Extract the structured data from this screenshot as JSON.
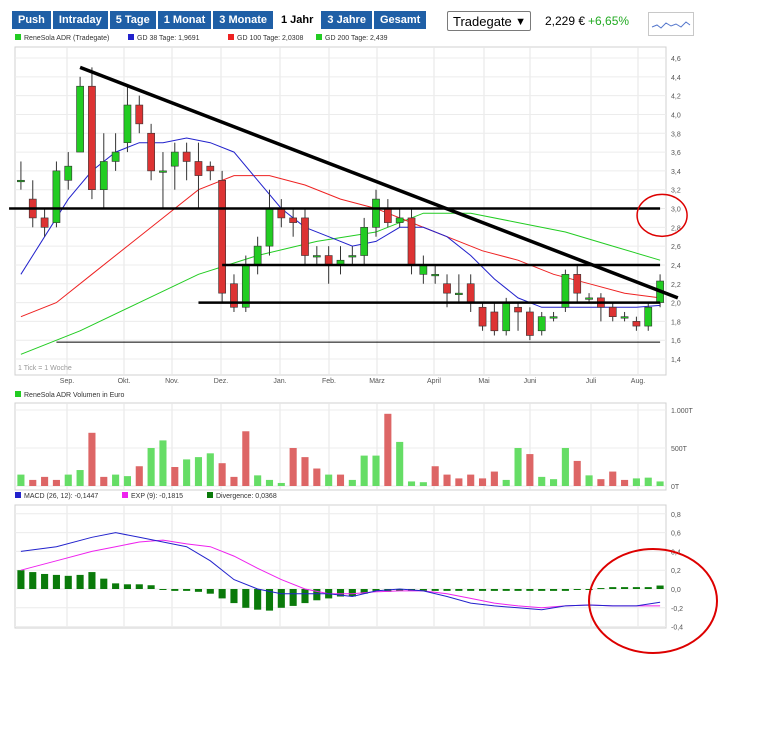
{
  "tabs": [
    {
      "label": "Push",
      "active": false
    },
    {
      "label": "Intraday",
      "active": false
    },
    {
      "label": "5 Tage",
      "active": false
    },
    {
      "label": "1 Monat",
      "active": false
    },
    {
      "label": "3 Monate",
      "active": false
    },
    {
      "label": "1 Jahr",
      "active": true
    },
    {
      "label": "3 Jahre",
      "active": false
    },
    {
      "label": "Gesamt",
      "active": false
    }
  ],
  "exchange": "Tradegate",
  "price": "2,229 €",
  "change": "+6,65%",
  "colors": {
    "up": "#22cc22",
    "down": "#dd3333",
    "gd38": "#2222cc",
    "gd100": "#ee2222",
    "gd200": "#22cc22",
    "macd": "#2222cc",
    "exp": "#ee22ee",
    "divergence": "#0a7a0a",
    "tabs": "#1f5fa6"
  },
  "main_legend": [
    "ReneSola ADR (Tradegate)",
    "GD 38 Tage: 1,9691",
    "GD 100 Tage: 2,0308",
    "GD 200 Tage: 2,439"
  ],
  "tick_note": "1 Tick = 1 Woche",
  "months": [
    "Sep.",
    "Okt.",
    "Nov.",
    "Dez.",
    "Jan.",
    "Feb.",
    "März",
    "April",
    "Mai",
    "Juni",
    "Juli",
    "Aug."
  ],
  "price_ticks": [
    "4,6",
    "4,4",
    "4,2",
    "4,0",
    "3,8",
    "3,6",
    "3,4",
    "3,2",
    "3,0",
    "2,8",
    "2,6",
    "2,4",
    "2,2",
    "2,0",
    "1,8",
    "1,6",
    "1,4"
  ],
  "volume_legend": "ReneSola ADR Volumen in Euro",
  "volume_ticks": [
    "1.000T",
    "500T",
    "0T"
  ],
  "macd_legend": [
    "MACD (26, 12): -0,1447",
    "EXP (9): -0,1815",
    "Divergence: 0,0368"
  ],
  "macd_ticks": [
    "0,8",
    "0,6",
    "0,4",
    "0,2",
    "0,0",
    "-0,2",
    "-0,4"
  ],
  "chart_data": [
    {
      "type": "candlestick",
      "title": "ReneSola ADR (Tradegate)",
      "interval": "1 Tick = 1 Woche",
      "ylim": [
        1.4,
        4.6
      ],
      "candles": [
        {
          "o": 3.3,
          "c": 3.3,
          "h": 3.5,
          "l": 3.2
        },
        {
          "o": 3.1,
          "c": 2.9,
          "h": 3.3,
          "l": 2.8
        },
        {
          "o": 2.9,
          "c": 2.8,
          "h": 3.0,
          "l": 2.7
        },
        {
          "o": 2.85,
          "c": 3.4,
          "h": 3.5,
          "l": 2.8
        },
        {
          "o": 3.3,
          "c": 3.45,
          "h": 3.6,
          "l": 3.2
        },
        {
          "o": 3.6,
          "c": 4.3,
          "h": 4.4,
          "l": 3.6
        },
        {
          "o": 4.3,
          "c": 3.2,
          "h": 4.5,
          "l": 3.1
        },
        {
          "o": 3.2,
          "c": 3.5,
          "h": 3.8,
          "l": 3.0
        },
        {
          "o": 3.5,
          "c": 3.6,
          "h": 3.8,
          "l": 3.4
        },
        {
          "o": 3.7,
          "c": 4.1,
          "h": 4.3,
          "l": 3.6
        },
        {
          "o": 4.1,
          "c": 3.9,
          "h": 4.2,
          "l": 3.8
        },
        {
          "o": 3.8,
          "c": 3.4,
          "h": 3.9,
          "l": 3.3
        },
        {
          "o": 3.4,
          "c": 3.4,
          "h": 3.6,
          "l": 3.0
        },
        {
          "o": 3.45,
          "c": 3.6,
          "h": 3.7,
          "l": 3.2
        },
        {
          "o": 3.6,
          "c": 3.5,
          "h": 3.7,
          "l": 3.3
        },
        {
          "o": 3.5,
          "c": 3.35,
          "h": 3.7,
          "l": 3.0
        },
        {
          "o": 3.45,
          "c": 3.4,
          "h": 3.5,
          "l": 3.3
        },
        {
          "o": 3.3,
          "c": 2.1,
          "h": 3.4,
          "l": 2.0
        },
        {
          "o": 2.2,
          "c": 1.95,
          "h": 2.3,
          "l": 1.9
        },
        {
          "o": 1.95,
          "c": 2.4,
          "h": 2.5,
          "l": 1.9
        },
        {
          "o": 2.4,
          "c": 2.6,
          "h": 2.7,
          "l": 2.3
        },
        {
          "o": 2.6,
          "c": 3.0,
          "h": 3.2,
          "l": 2.5
        },
        {
          "o": 3.0,
          "c": 2.9,
          "h": 3.1,
          "l": 2.8
        },
        {
          "o": 2.9,
          "c": 2.85,
          "h": 3.0,
          "l": 2.7
        },
        {
          "o": 2.9,
          "c": 2.5,
          "h": 3.0,
          "l": 2.4
        },
        {
          "o": 2.5,
          "c": 2.5,
          "h": 2.6,
          "l": 2.4
        },
        {
          "o": 2.5,
          "c": 2.4,
          "h": 2.6,
          "l": 2.2
        },
        {
          "o": 2.4,
          "c": 2.45,
          "h": 2.6,
          "l": 2.3
        },
        {
          "o": 2.5,
          "c": 2.5,
          "h": 2.6,
          "l": 2.4
        },
        {
          "o": 2.5,
          "c": 2.8,
          "h": 2.9,
          "l": 2.4
        },
        {
          "o": 2.8,
          "c": 3.1,
          "h": 3.2,
          "l": 2.7
        },
        {
          "o": 3.0,
          "c": 2.85,
          "h": 3.1,
          "l": 2.8
        },
        {
          "o": 2.85,
          "c": 2.9,
          "h": 3.0,
          "l": 2.8
        },
        {
          "o": 2.9,
          "c": 2.4,
          "h": 3.0,
          "l": 2.3
        },
        {
          "o": 2.3,
          "c": 2.4,
          "h": 2.5,
          "l": 2.2
        },
        {
          "o": 2.3,
          "c": 2.3,
          "h": 2.4,
          "l": 2.2
        },
        {
          "o": 2.2,
          "c": 2.1,
          "h": 2.3,
          "l": 1.95
        },
        {
          "o": 2.1,
          "c": 2.1,
          "h": 2.3,
          "l": 2.0
        },
        {
          "o": 2.2,
          "c": 2.0,
          "h": 2.3,
          "l": 1.9
        },
        {
          "o": 1.95,
          "c": 1.75,
          "h": 2.0,
          "l": 1.7
        },
        {
          "o": 1.9,
          "c": 1.7,
          "h": 2.0,
          "l": 1.65
        },
        {
          "o": 1.7,
          "c": 2.0,
          "h": 2.05,
          "l": 1.65
        },
        {
          "o": 1.95,
          "c": 1.9,
          "h": 2.0,
          "l": 1.7
        },
        {
          "o": 1.9,
          "c": 1.65,
          "h": 1.95,
          "l": 1.6
        },
        {
          "o": 1.7,
          "c": 1.85,
          "h": 1.9,
          "l": 1.65
        },
        {
          "o": 1.85,
          "c": 1.85,
          "h": 1.9,
          "l": 1.8
        },
        {
          "o": 1.95,
          "c": 2.3,
          "h": 2.35,
          "l": 1.9
        },
        {
          "o": 2.3,
          "c": 2.1,
          "h": 2.4,
          "l": 2.0
        },
        {
          "o": 2.05,
          "c": 2.05,
          "h": 2.1,
          "l": 2.0
        },
        {
          "o": 2.05,
          "c": 1.95,
          "h": 2.1,
          "l": 1.8
        },
        {
          "o": 1.95,
          "c": 1.85,
          "h": 2.0,
          "l": 1.8
        },
        {
          "o": 1.85,
          "c": 1.85,
          "h": 1.9,
          "l": 1.8
        },
        {
          "o": 1.8,
          "c": 1.75,
          "h": 1.85,
          "l": 1.7
        },
        {
          "o": 1.75,
          "c": 1.95,
          "h": 2.0,
          "l": 1.7
        },
        {
          "o": 2.0,
          "c": 2.229,
          "h": 2.3,
          "l": 1.95
        }
      ],
      "series": [
        {
          "name": "GD 38 Tage: 1,9691",
          "x": [
            0,
            2,
            4,
            6,
            8,
            10,
            12,
            14,
            16,
            18,
            20,
            22,
            24,
            26,
            28,
            30,
            32,
            34,
            36,
            38,
            40,
            42,
            44,
            46,
            48,
            50,
            52,
            54
          ],
          "values": [
            2.3,
            2.7,
            3.1,
            3.4,
            3.6,
            3.7,
            3.7,
            3.75,
            3.7,
            3.6,
            3.3,
            3.0,
            2.8,
            2.7,
            2.6,
            2.65,
            2.8,
            2.8,
            2.7,
            2.5,
            2.25,
            2.05,
            1.95,
            1.95,
            1.95,
            1.95,
            1.95,
            1.97
          ]
        },
        {
          "name": "GD 100 Tage: 2,0308",
          "x": [
            0,
            3,
            6,
            9,
            12,
            15,
            18,
            21,
            24,
            27,
            30,
            33,
            36,
            39,
            42,
            45,
            48,
            51,
            54
          ],
          "values": [
            1.85,
            2.0,
            2.3,
            2.6,
            2.9,
            3.2,
            3.35,
            3.35,
            3.25,
            3.1,
            3.0,
            2.85,
            2.7,
            2.55,
            2.45,
            2.3,
            2.2,
            2.1,
            2.05
          ]
        },
        {
          "name": "GD 200 Tage: 2,439",
          "x": [
            0,
            5,
            10,
            15,
            20,
            25,
            30,
            34,
            38,
            42,
            46,
            50,
            54
          ],
          "values": [
            1.45,
            1.7,
            2.0,
            2.3,
            2.5,
            2.65,
            2.75,
            2.95,
            2.95,
            2.85,
            2.75,
            2.6,
            2.45
          ]
        }
      ],
      "trend_lines": [
        {
          "from": [
            5,
            4.5
          ],
          "to": [
            55.5,
            2.05
          ]
        },
        {
          "from": [
            -1,
            3.0
          ],
          "to": [
            54,
            3.0
          ]
        },
        {
          "from": [
            17,
            2.4
          ],
          "to": [
            54,
            2.4
          ]
        },
        {
          "from": [
            15,
            2.0
          ],
          "to": [
            54,
            2.0
          ]
        },
        {
          "from": [
            3,
            1.58
          ],
          "to": [
            54,
            1.58
          ]
        }
      ],
      "annotations": [
        {
          "shape": "ellipse",
          "x": 54,
          "y": 2.98
        }
      ]
    },
    {
      "type": "bar",
      "title": "ReneSola ADR Volumen in Euro",
      "unit": "T",
      "ylim": [
        0,
        1000
      ],
      "values": [
        150,
        80,
        120,
        80,
        150,
        210,
        700,
        120,
        150,
        130,
        260,
        500,
        600,
        250,
        350,
        380,
        430,
        300,
        120,
        720,
        140,
        80,
        40,
        500,
        380,
        230,
        150,
        150,
        80,
        400,
        400,
        950,
        580,
        60,
        50,
        260,
        150,
        100,
        150,
        100,
        190,
        80,
        500,
        420,
        120,
        90,
        500,
        330,
        140,
        90,
        190,
        80,
        100,
        110,
        60
      ],
      "up": [
        1,
        0,
        0,
        0,
        1,
        1,
        0,
        0,
        1,
        1,
        0,
        1,
        1,
        0,
        1,
        1,
        1,
        0,
        0,
        0,
        1,
        1,
        1,
        0,
        0,
        0,
        1,
        0,
        1,
        1,
        1,
        0,
        1,
        1,
        1,
        0,
        0,
        0,
        0,
        0,
        0,
        1,
        1,
        0,
        1,
        1,
        1,
        0,
        1,
        0,
        0,
        0,
        1,
        1,
        1
      ]
    },
    {
      "type": "line",
      "title": "MACD",
      "ylim": [
        -0.4,
        0.8
      ],
      "series": [
        {
          "name": "MACD (26, 12): -0,1447",
          "x": [
            0,
            3,
            6,
            8,
            10,
            12,
            14,
            16,
            18,
            20,
            22,
            24,
            26,
            28,
            30,
            32,
            34,
            36,
            38,
            40,
            42,
            44,
            46,
            48,
            50,
            52,
            54
          ],
          "values": [
            0.4,
            0.45,
            0.55,
            0.6,
            0.55,
            0.5,
            0.45,
            0.3,
            0.1,
            0.0,
            -0.05,
            -0.05,
            -0.05,
            -0.08,
            -0.02,
            0.0,
            -0.02,
            -0.08,
            -0.15,
            -0.18,
            -0.2,
            -0.22,
            -0.18,
            -0.17,
            -0.18,
            -0.18,
            -0.14
          ]
        },
        {
          "name": "EXP (9): -0,1815",
          "x": [
            0,
            3,
            6,
            8,
            10,
            12,
            14,
            16,
            18,
            20,
            22,
            24,
            26,
            28,
            30,
            32,
            34,
            36,
            38,
            40,
            42,
            44,
            46,
            48,
            50,
            52,
            54
          ],
          "values": [
            0.2,
            0.3,
            0.4,
            0.45,
            0.5,
            0.52,
            0.48,
            0.45,
            0.35,
            0.22,
            0.1,
            0.0,
            -0.05,
            -0.05,
            -0.03,
            -0.02,
            -0.02,
            -0.05,
            -0.1,
            -0.15,
            -0.18,
            -0.2,
            -0.18,
            -0.17,
            -0.18,
            -0.18,
            -0.18
          ]
        },
        {
          "name": "Divergence: 0,0368",
          "values": [
            0.2,
            0.18,
            0.16,
            0.15,
            0.14,
            0.15,
            0.18,
            0.11,
            0.06,
            0.05,
            0.05,
            0.04,
            0.0,
            -0.02,
            -0.02,
            -0.03,
            -0.05,
            -0.1,
            -0.15,
            -0.2,
            -0.22,
            -0.23,
            -0.2,
            -0.18,
            -0.15,
            -0.12,
            -0.1,
            -0.08,
            -0.08,
            -0.05,
            -0.02,
            -0.03,
            -0.02,
            -0.02,
            -0.02,
            -0.02,
            -0.02,
            -0.02,
            -0.02,
            -0.02,
            -0.02,
            -0.02,
            -0.02,
            -0.02,
            -0.02,
            -0.02,
            -0.02,
            -0.01,
            -0.01,
            0.01,
            0.02,
            0.02,
            0.02,
            0.02,
            0.037
          ]
        }
      ],
      "annotations": [
        {
          "shape": "ellipse",
          "x": 52,
          "y": -0.15
        }
      ]
    }
  ]
}
